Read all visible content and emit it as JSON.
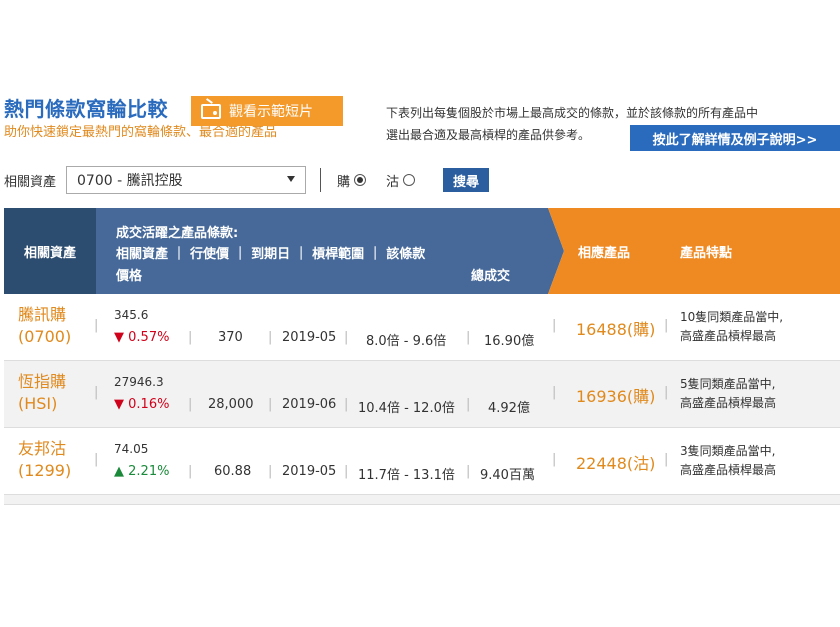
{
  "hero": {
    "title": "熱門條款窩輪比較",
    "subtitle": "助你快速鎖定最熱門的窩輪條款、最合適的產品",
    "video_button": "觀看示範短片"
  },
  "description": {
    "line1": "下表列出每隻個股於市場上最高成交的條款，並於該條款的所有產品中",
    "line2": "選出最合適及最高槓桿的產品供參考。",
    "info_button": "按此了解詳情及例子說明>>"
  },
  "filter": {
    "label": "相關資產",
    "selected_asset": "0700 - 騰訊控股",
    "option_call": "購",
    "option_put": "沽",
    "selected_option": "購",
    "search_button": "搜尋"
  },
  "table": {
    "headers": {
      "asset": "相關資產",
      "terms_title": "成交活躍之產品條款:",
      "terms_cols": "相關資產 ｜ 行使價 ｜ 到期日 ｜ 槓桿範圍 ｜ 該條款",
      "terms_price": "價格",
      "terms_volume": "總成交",
      "product": "相應產品",
      "features": "產品特點"
    },
    "rows": [
      {
        "asset_name": "騰訊購",
        "asset_code": "(0700)",
        "price": "345.6",
        "direction": "down",
        "change": "0.57%",
        "strike": "370",
        "expiry": "2019-05",
        "leverage": "8.0倍 - 9.6倍",
        "volume": "16.90億",
        "product": "16488(購)",
        "feature_line1": "10隻同類產品當中,",
        "feature_line2": "高盛產品槓桿最高"
      },
      {
        "asset_name": "恆指購",
        "asset_code": "(HSI)",
        "price": "27946.3",
        "direction": "down",
        "change": "0.16%",
        "strike": "28,000",
        "expiry": "2019-06",
        "leverage": "10.4倍 - 12.0倍",
        "volume": "4.92億",
        "product": "16936(購)",
        "feature_line1": "5隻同類產品當中,",
        "feature_line2": "高盛產品槓桿最高"
      },
      {
        "asset_name": "友邦沽",
        "asset_code": "(1299)",
        "price": "74.05",
        "direction": "up",
        "change": "2.21%",
        "strike": "60.88",
        "expiry": "2019-05",
        "leverage": "11.7倍 - 13.1倍",
        "volume": "9.40百萬",
        "product": "22448(沽)",
        "feature_line1": "3隻同類產品當中,",
        "feature_line2": "高盛產品槓桿最高"
      }
    ]
  },
  "colors": {
    "blue": "#2a6bbd",
    "orange": "#ef8a22",
    "header_dark": "#2c4c70",
    "header_mid": "#46699a",
    "down": "#d0021b",
    "up": "#1a8a3a"
  }
}
